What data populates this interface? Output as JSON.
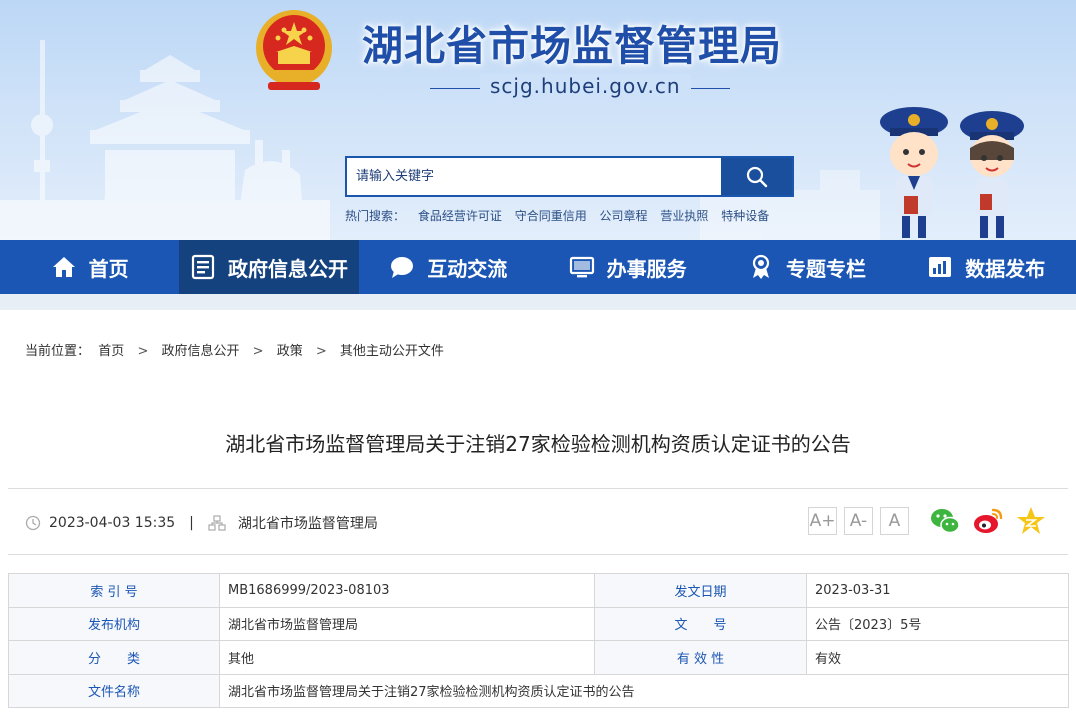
{
  "header": {
    "site_title": "湖北省市场监督管理局",
    "site_domain": "scjg.hubei.gov.cn",
    "search": {
      "placeholder": "请输入关键字"
    },
    "hot_search": {
      "label": "热门搜索：",
      "items": [
        "食品经营许可证",
        "守合同重信用",
        "公司章程",
        "营业执照",
        "特种设备"
      ]
    }
  },
  "nav": {
    "items": [
      {
        "label": "首页",
        "icon": "home-icon"
      },
      {
        "label": "政府信息公开",
        "icon": "document-list-icon",
        "active": true
      },
      {
        "label": "互动交流",
        "icon": "chat-bubble-icon"
      },
      {
        "label": "办事服务",
        "icon": "monitor-icon"
      },
      {
        "label": "专题专栏",
        "icon": "award-icon"
      },
      {
        "label": "数据发布",
        "icon": "bar-chart-icon"
      }
    ]
  },
  "breadcrumb": {
    "label": "当前位置：",
    "items": [
      "首页",
      "政府信息公开",
      "政策",
      "其他主动公开文件"
    ],
    "separator": ">"
  },
  "article": {
    "title": "湖北省市场监督管理局关于注销27家检验检测机构资质认定证书的公告",
    "datetime": "2023-04-03 15:35",
    "separator": "|",
    "source": "湖北省市场监督管理局",
    "font_buttons": [
      "A+",
      "A-",
      "A"
    ]
  },
  "share": [
    "wechat-icon",
    "weibo-icon",
    "qzone-icon"
  ],
  "info_table": {
    "rows": [
      [
        {
          "label": "索 引 号",
          "value": "MB1686999/2023-08103"
        },
        {
          "label": "发文日期",
          "value": "2023-03-31"
        }
      ],
      [
        {
          "label": "发布机构",
          "value": "湖北省市场监督管理局"
        },
        {
          "label": "文　　号",
          "value": "公告〔2023〕5号"
        }
      ],
      [
        {
          "label": "分　　类",
          "value": "其他"
        },
        {
          "label": "有 效 性",
          "value": "有效"
        }
      ]
    ],
    "file_name": {
      "label": "文件名称",
      "value": "湖北省市场监督管理局关于注销27家检验检测机构资质认定证书的公告"
    }
  },
  "colors": {
    "nav_bg": "#1b56b4",
    "nav_active": "#14427f",
    "title_blue": "#1f4fa8",
    "table_label": "#1b56b4"
  }
}
